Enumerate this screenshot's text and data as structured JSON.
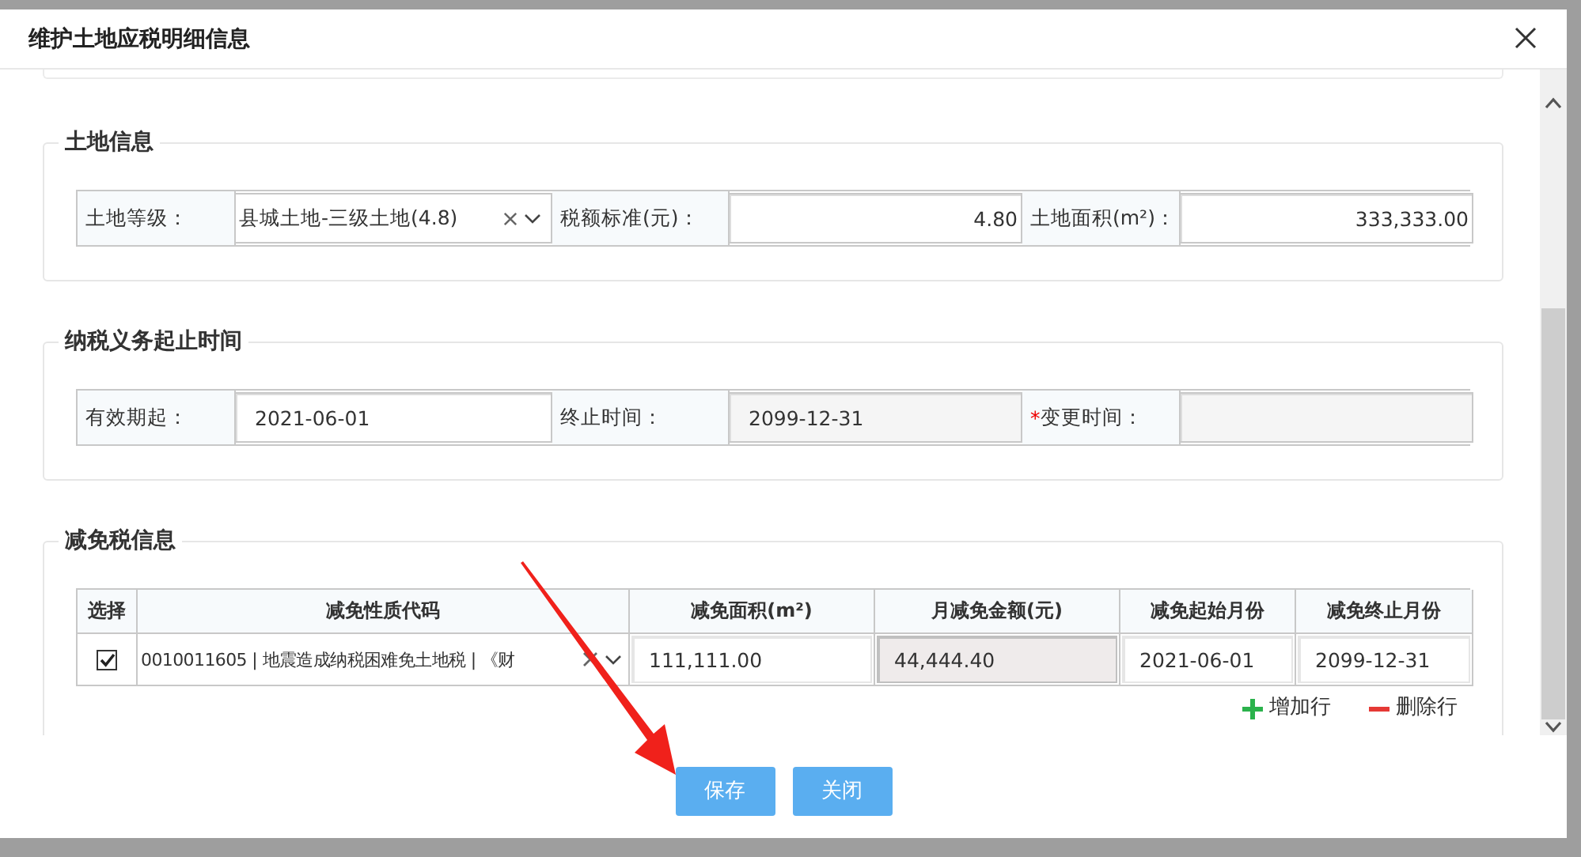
{
  "dialog": {
    "title": "维护土地应税明细信息"
  },
  "sections": [
    {
      "kind": "fields",
      "legend": "土地信息",
      "fields": [
        {
          "label": "土地等级：",
          "kind": "select",
          "value": "县城土地-三级土地(4.8)"
        },
        {
          "label": "税额标准(元)：",
          "kind": "number",
          "value": "4.80"
        },
        {
          "label": "土地面积(m²)：",
          "kind": "number",
          "value": "333,333.00"
        }
      ]
    },
    {
      "kind": "fields",
      "legend": "纳税义务起止时间",
      "fields": [
        {
          "label": "有效期起：",
          "kind": "text",
          "value": "2021-06-01"
        },
        {
          "label": "终止时间：",
          "kind": "readonly",
          "value": "2099-12-31"
        },
        {
          "label": "变更时间：",
          "required_mark": "*",
          "kind": "readonly"
        }
      ]
    },
    {
      "kind": "table",
      "legend": "减免税信息",
      "columns": [
        "选择",
        "减免性质代码",
        "减免面积(m²)",
        "月减免金额(元)",
        "减免起始月份",
        "减免终止月份"
      ],
      "rows": [
        {
          "cells": [
            {
              "kind": "checkbox",
              "checked": true
            },
            {
              "kind": "select",
              "value": "0010011605 | 地震造成纳税困难免土地税 | 《财"
            },
            {
              "kind": "text",
              "value": "111,111.00"
            },
            {
              "kind": "readonly",
              "value": "44,444.40"
            },
            {
              "kind": "text",
              "value": "2021-06-01"
            },
            {
              "kind": "text",
              "value": "2099-12-31"
            }
          ]
        }
      ],
      "actions": [
        {
          "kind": "add",
          "label": "增加行"
        },
        {
          "kind": "remove",
          "label": "删除行"
        }
      ]
    }
  ],
  "buttons": [
    {
      "label": "保存"
    },
    {
      "label": "关闭"
    }
  ]
}
